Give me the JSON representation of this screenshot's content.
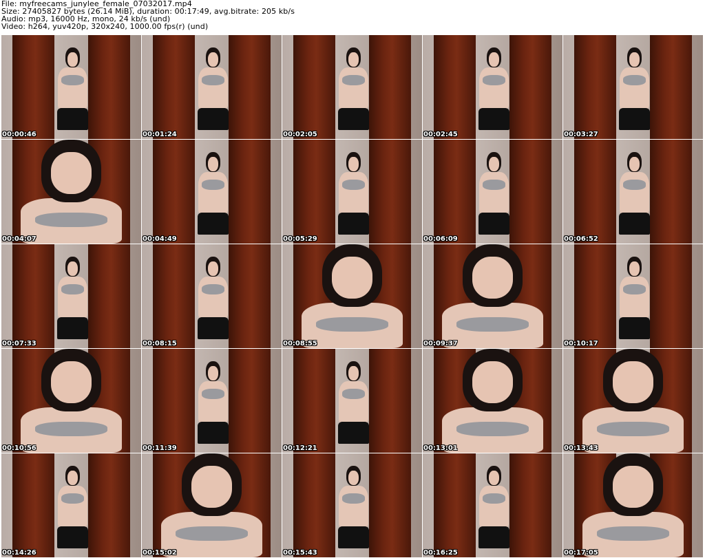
{
  "header": {
    "file": "File: myfreecams_junylee_female_07032017.mp4",
    "size": "Size: 27405827 bytes (26.14 MiB), duration: 00:17:49, avg.bitrate: 205 kb/s",
    "audio": "Audio: mp3, 16000 Hz, mono, 24 kb/s (und)",
    "video": "Video: h264, yuv420p, 320x240, 1000.00 fps(r) (und)"
  },
  "thumbnails": [
    {
      "timestamp": "00:00:46",
      "framing": "full"
    },
    {
      "timestamp": "00:01:24",
      "framing": "full"
    },
    {
      "timestamp": "00:02:05",
      "framing": "full"
    },
    {
      "timestamp": "00:02:45",
      "framing": "full"
    },
    {
      "timestamp": "00:03:27",
      "framing": "full"
    },
    {
      "timestamp": "00:04:07",
      "framing": "close"
    },
    {
      "timestamp": "00:04:49",
      "framing": "full"
    },
    {
      "timestamp": "00:05:29",
      "framing": "full"
    },
    {
      "timestamp": "00:06:09",
      "framing": "full"
    },
    {
      "timestamp": "00:06:52",
      "framing": "full"
    },
    {
      "timestamp": "00:07:33",
      "framing": "full"
    },
    {
      "timestamp": "00:08:15",
      "framing": "full"
    },
    {
      "timestamp": "00:08:55",
      "framing": "close"
    },
    {
      "timestamp": "00:09:37",
      "framing": "close"
    },
    {
      "timestamp": "00:10:17",
      "framing": "full"
    },
    {
      "timestamp": "00:10:56",
      "framing": "close"
    },
    {
      "timestamp": "00:11:39",
      "framing": "full"
    },
    {
      "timestamp": "00:12:21",
      "framing": "full"
    },
    {
      "timestamp": "00:13:01",
      "framing": "close"
    },
    {
      "timestamp": "00:13:43",
      "framing": "close"
    },
    {
      "timestamp": "00:14:26",
      "framing": "full"
    },
    {
      "timestamp": "00:15:02",
      "framing": "close"
    },
    {
      "timestamp": "00:15:43",
      "framing": "full"
    },
    {
      "timestamp": "00:16:25",
      "framing": "full"
    },
    {
      "timestamp": "00:17:05",
      "framing": "close"
    }
  ]
}
